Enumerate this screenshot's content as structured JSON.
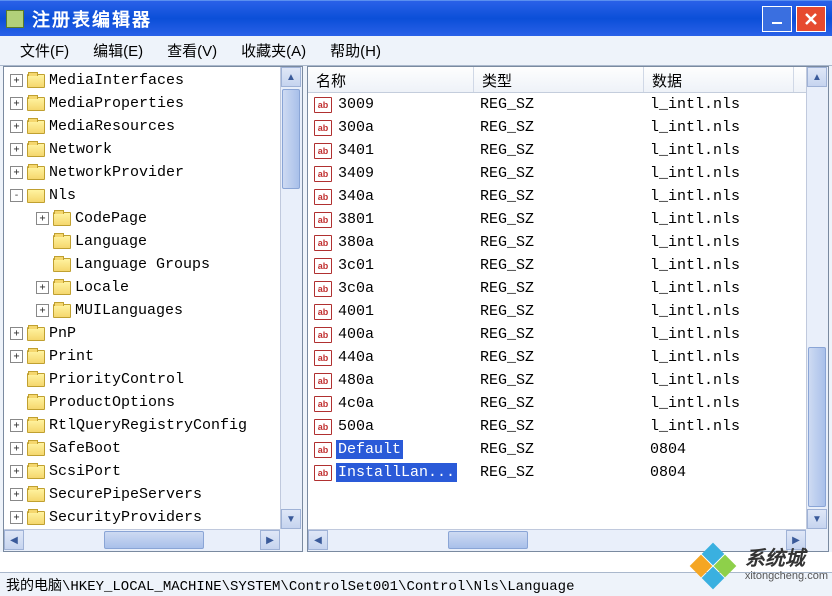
{
  "window": {
    "title": "注册表编辑器"
  },
  "menu": {
    "file": "文件(F)",
    "edit": "编辑(E)",
    "view": "查看(V)",
    "favorites": "收藏夹(A)",
    "help": "帮助(H)"
  },
  "tree": [
    {
      "depth": 0,
      "exp": "+",
      "label": "MediaInterfaces"
    },
    {
      "depth": 0,
      "exp": "+",
      "label": "MediaProperties"
    },
    {
      "depth": 0,
      "exp": "+",
      "label": "MediaResources"
    },
    {
      "depth": 0,
      "exp": "+",
      "label": "Network"
    },
    {
      "depth": 0,
      "exp": "+",
      "label": "NetworkProvider"
    },
    {
      "depth": 0,
      "exp": "-",
      "label": "Nls",
      "open": true
    },
    {
      "depth": 1,
      "exp": "+",
      "label": "CodePage"
    },
    {
      "depth": 1,
      "exp": "",
      "label": "Language"
    },
    {
      "depth": 1,
      "exp": "",
      "label": "Language Groups"
    },
    {
      "depth": 1,
      "exp": "+",
      "label": "Locale"
    },
    {
      "depth": 1,
      "exp": "+",
      "label": "MUILanguages"
    },
    {
      "depth": 0,
      "exp": "+",
      "label": "PnP"
    },
    {
      "depth": 0,
      "exp": "+",
      "label": "Print"
    },
    {
      "depth": 0,
      "exp": "",
      "label": "PriorityControl"
    },
    {
      "depth": 0,
      "exp": "",
      "label": "ProductOptions"
    },
    {
      "depth": 0,
      "exp": "+",
      "label": "RtlQueryRegistryConfig"
    },
    {
      "depth": 0,
      "exp": "+",
      "label": "SafeBoot"
    },
    {
      "depth": 0,
      "exp": "+",
      "label": "ScsiPort"
    },
    {
      "depth": 0,
      "exp": "+",
      "label": "SecurePipeServers"
    },
    {
      "depth": 0,
      "exp": "+",
      "label": "SecurityProviders"
    }
  ],
  "list": {
    "columns": {
      "name": "名称",
      "type": "类型",
      "data": "数据"
    },
    "col_widths": {
      "name": 166,
      "type": 170,
      "data": 150
    },
    "rows": [
      {
        "name": "3009",
        "type": "REG_SZ",
        "data": "l_intl.nls"
      },
      {
        "name": "300a",
        "type": "REG_SZ",
        "data": "l_intl.nls"
      },
      {
        "name": "3401",
        "type": "REG_SZ",
        "data": "l_intl.nls"
      },
      {
        "name": "3409",
        "type": "REG_SZ",
        "data": "l_intl.nls"
      },
      {
        "name": "340a",
        "type": "REG_SZ",
        "data": "l_intl.nls"
      },
      {
        "name": "3801",
        "type": "REG_SZ",
        "data": "l_intl.nls"
      },
      {
        "name": "380a",
        "type": "REG_SZ",
        "data": "l_intl.nls"
      },
      {
        "name": "3c01",
        "type": "REG_SZ",
        "data": "l_intl.nls"
      },
      {
        "name": "3c0a",
        "type": "REG_SZ",
        "data": "l_intl.nls"
      },
      {
        "name": "4001",
        "type": "REG_SZ",
        "data": "l_intl.nls"
      },
      {
        "name": "400a",
        "type": "REG_SZ",
        "data": "l_intl.nls"
      },
      {
        "name": "440a",
        "type": "REG_SZ",
        "data": "l_intl.nls"
      },
      {
        "name": "480a",
        "type": "REG_SZ",
        "data": "l_intl.nls"
      },
      {
        "name": "4c0a",
        "type": "REG_SZ",
        "data": "l_intl.nls"
      },
      {
        "name": "500a",
        "type": "REG_SZ",
        "data": "l_intl.nls"
      },
      {
        "name": "Default",
        "type": "REG_SZ",
        "data": "0804",
        "selected": true
      },
      {
        "name": "InstallLan...",
        "type": "REG_SZ",
        "data": "0804",
        "selected": true
      }
    ]
  },
  "statusbar": {
    "path": "我的电脑\\HKEY_LOCAL_MACHINE\\SYSTEM\\ControlSet001\\Control\\Nls\\Language"
  },
  "watermark": {
    "main": "系统城",
    "sub": "xitongcheng.com"
  }
}
